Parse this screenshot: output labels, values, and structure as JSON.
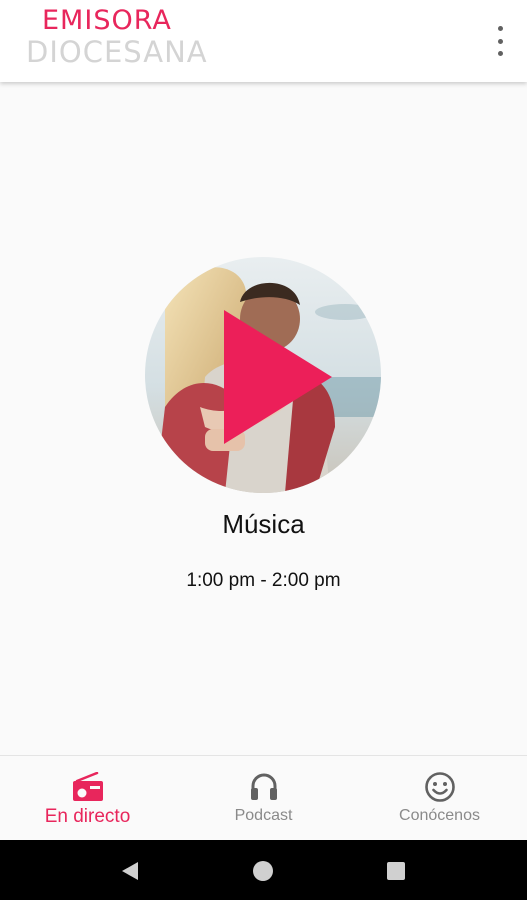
{
  "app": {
    "logo_line1": "EMISORA",
    "logo_line2": "DIOCESANA",
    "brand_color": "#e8265c",
    "menu_icon": "more-vert-icon"
  },
  "player": {
    "program_title": "Música",
    "program_time": "1:00 pm - 2:00 pm",
    "play_icon": "play-icon",
    "artwork": "couple-embracing-photo"
  },
  "bottom_nav": {
    "items": [
      {
        "label": "En directo",
        "icon": "radio-icon",
        "active": true
      },
      {
        "label": "Podcast",
        "icon": "headphones-icon",
        "active": false
      },
      {
        "label": "Conócenos",
        "icon": "smiley-icon",
        "active": false
      }
    ]
  },
  "system_nav": {
    "back_icon": "back-triangle-icon",
    "home_icon": "home-circle-icon",
    "recents_icon": "recents-square-icon"
  }
}
